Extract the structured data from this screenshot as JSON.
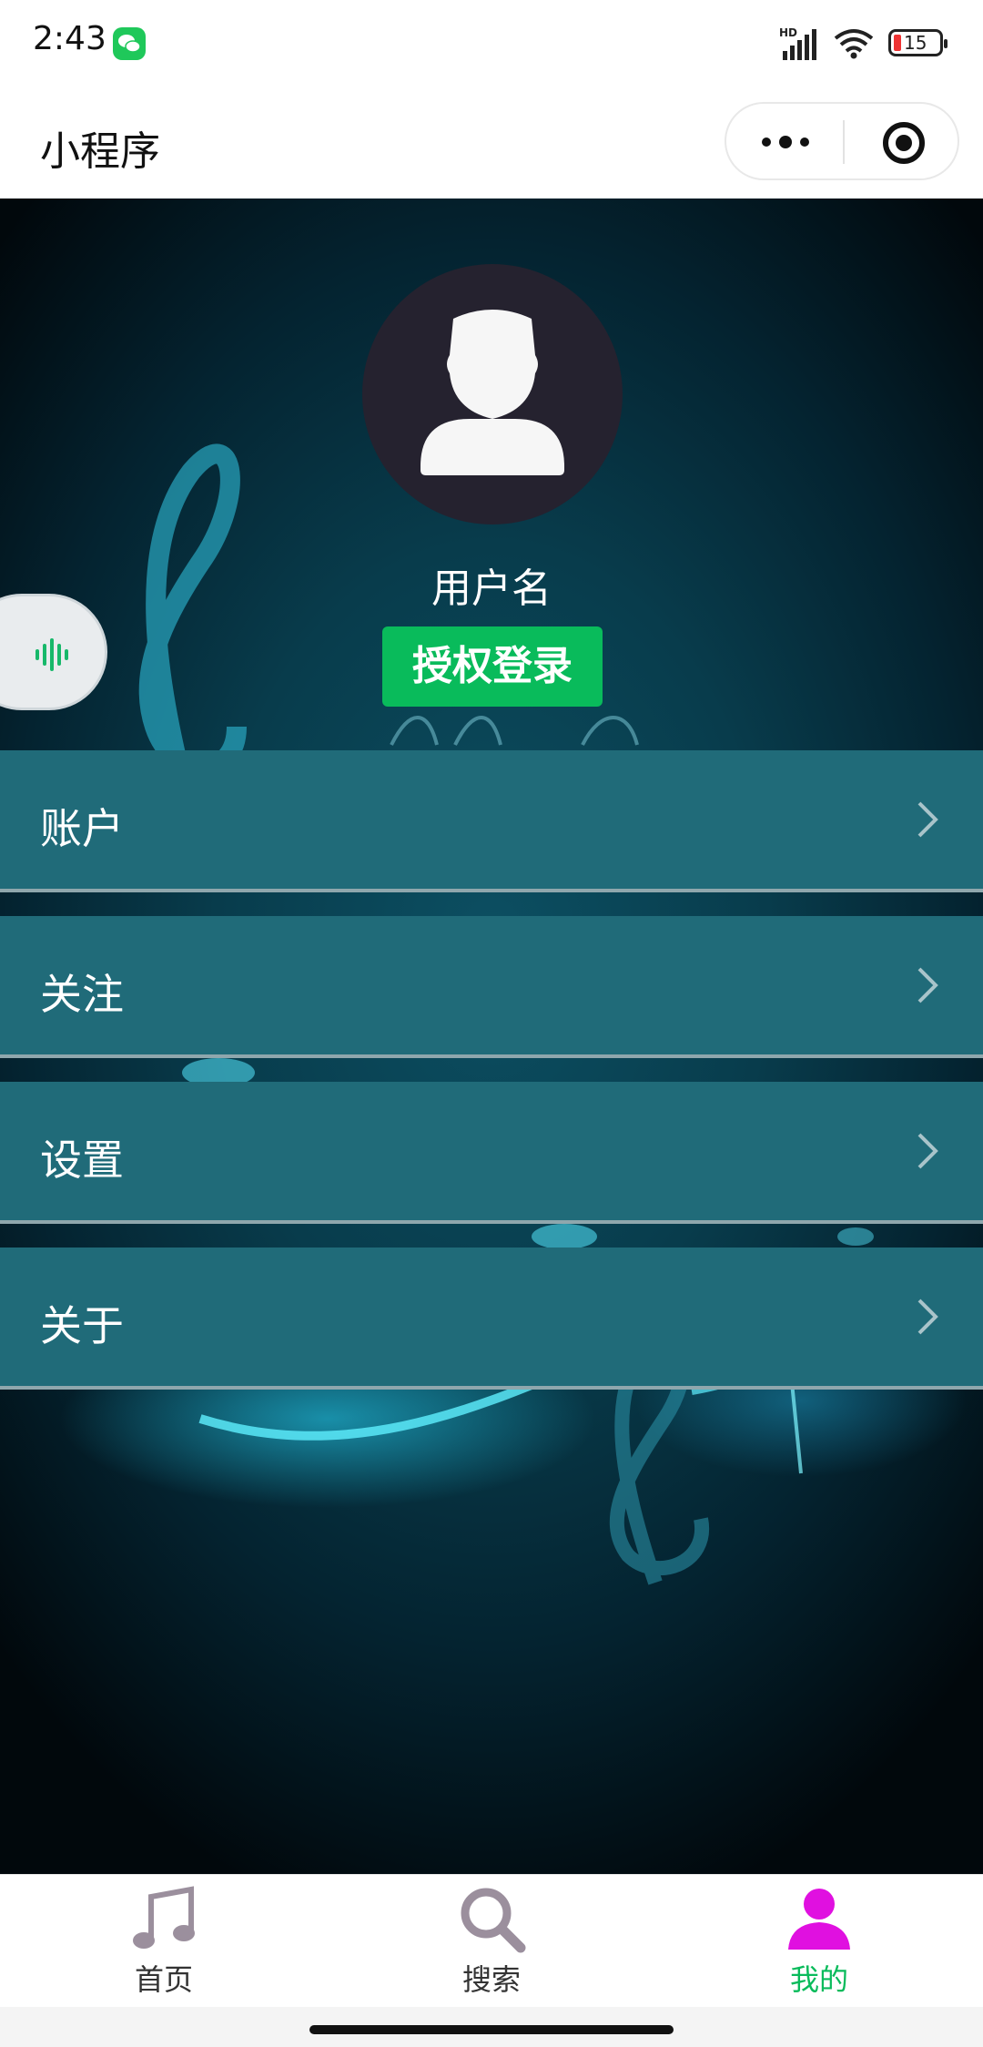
{
  "status_bar": {
    "time": "2:43",
    "battery": "15"
  },
  "nav": {
    "title": "小程序"
  },
  "profile": {
    "username": "用户名",
    "login_button": "授权登录"
  },
  "menu": {
    "items": [
      {
        "label": "账户"
      },
      {
        "label": "关注"
      },
      {
        "label": "设置"
      },
      {
        "label": "关于"
      }
    ]
  },
  "tabbar": {
    "active_index": 2,
    "items": [
      {
        "label": "首页",
        "icon": "music-note-icon"
      },
      {
        "label": "搜索",
        "icon": "search-icon"
      },
      {
        "label": "我的",
        "icon": "user-icon"
      }
    ]
  },
  "colors": {
    "accent_green": "#09bb5b",
    "menu_bg": "#206b79",
    "active_tab_icon": "#e010e0",
    "inactive_tab_icon": "#9b8f9d"
  }
}
